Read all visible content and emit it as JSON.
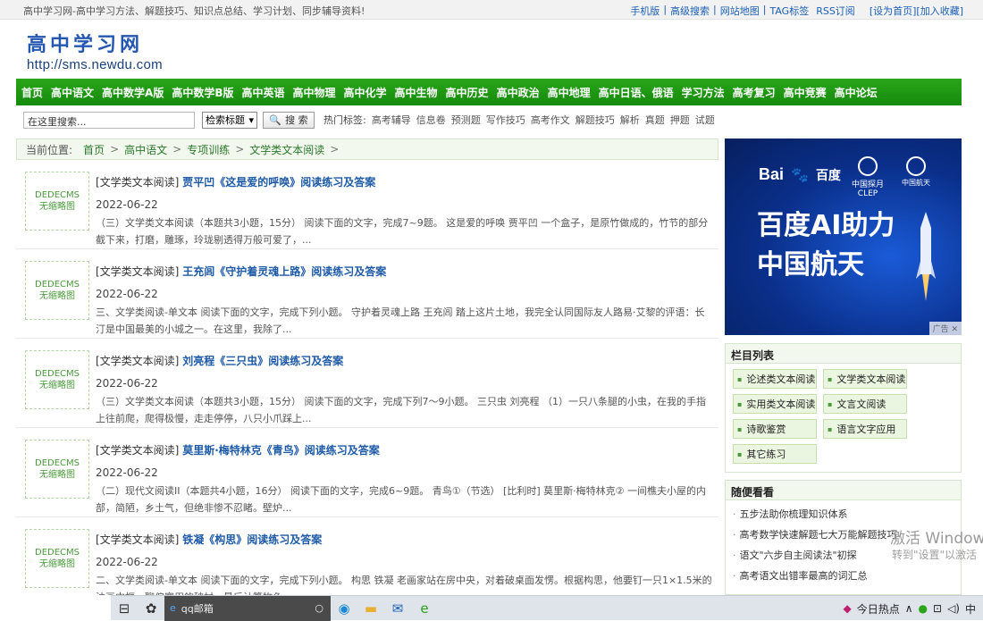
{
  "topbar": {
    "slogan": "高中学习网-高中学习方法、解题技巧、知识点总结、学习计划、同步辅导资料!",
    "links": [
      "手机版",
      "高级搜索",
      "网站地图",
      "TAG标签",
      "RSS订阅"
    ],
    "home": "[设为首页]",
    "fav": "[加入收藏]"
  },
  "logo": {
    "name": "高中学习网",
    "url": "http://sms.newdu.com"
  },
  "nav": [
    "首页",
    "高中语文",
    "高中数学A版",
    "高中数学B版",
    "高中英语",
    "高中物理",
    "高中化学",
    "高中生物",
    "高中历史",
    "高中政治",
    "高中地理",
    "高中日语、俄语",
    "学习方法",
    "高考复习",
    "高中竞赛",
    "高中论坛"
  ],
  "search": {
    "placeholder": "在这里搜索...",
    "select": "检索标题",
    "button": "搜 索",
    "hot_label": "热门标签:",
    "hot_tags": [
      "高考辅导",
      "信息卷",
      "预测题",
      "写作技巧",
      "高考作文",
      "解题技巧",
      "解析",
      "真题",
      "押题",
      "试题"
    ]
  },
  "breadcrumb": {
    "prefix": "当前位置:",
    "items": [
      "首页",
      "高中语文",
      "专项训练",
      "文学类文本阅读"
    ]
  },
  "thumb": {
    "line1": "DEDECMS",
    "line2": "无缩略图"
  },
  "articles": [
    {
      "cat": "[文学类文本阅读]",
      "title": "贾平凹《这是爱的呼唤》阅读练习及答案",
      "date": "2022-06-22",
      "desc": "（三）文学类文本阅读（本题共3小题，15分） 阅读下面的文字，完成7~9题。 这是爱的呼唤 贾平凹 一个盒子，是原竹做成的，竹节的部分截下来，打磨，雕琢，玲珑剔透得万般可爱了，..."
    },
    {
      "cat": "[文学类文本阅读]",
      "title": "王充闾《守护着灵魂上路》阅读练习及答案",
      "date": "2022-06-22",
      "desc": "三、文学类阅读-单文本 阅读下面的文字，完成下列小题。 守护着灵魂上路 王充闾 踏上这片土地，我完全认同国际友人路易·艾黎的评语：长汀是中国最美的小城之一。在这里，我除了..."
    },
    {
      "cat": "[文学类文本阅读]",
      "title": "刘亮程《三只虫》阅读练习及答案",
      "date": "2022-06-22",
      "desc": "（三）文学类文本阅读（本题共3小题，15分） 阅读下面的文字，完成下列7～9小题。 三只虫 刘亮程 （1）一只八条腿的小虫，在我的手指上往前爬，爬得极慢，走走停停，八只小爪踩上..."
    },
    {
      "cat": "[文学类文本阅读]",
      "title": "莫里斯·梅特林克《青鸟》阅读练习及答案",
      "date": "2022-06-22",
      "desc": "（二）现代文阅读II（本题共4小题，16分） 阅读下面的文字，完成6~9题。 青鸟①（节选） [比利时] 莫里斯·梅特林克② 一间樵夫小屋的内部，简陋，乡土气，但绝非惨不忍睹。壁炉..."
    },
    {
      "cat": "[文学类文本阅读]",
      "title": "铁凝《构思》阅读练习及答案",
      "date": "2022-06-22",
      "desc": "二、文学类阅读-单文本 阅读下面的文字，完成下列小题。 构思 铁凝 老画家站在房中央，对着破桌面发愣。根据构思，他要钉一只1×1.5米的油画内框，聊偏宽用的破材，最后计算物色..."
    }
  ],
  "ad": {
    "baidu": "Bai",
    "baidu2": "百度",
    "clep": "中国探月",
    "clep_en": "CLEP",
    "cnsa": "中国航天",
    "line1": "百度AI助力",
    "line2": "中国航天",
    "tag": "广告"
  },
  "columns": {
    "title": "栏目列表",
    "items": [
      "论述类文本阅读",
      "文学类文本阅读",
      "实用类文本阅读",
      "文言文阅读",
      "诗歌鉴赏",
      "语言文字应用",
      "其它练习"
    ]
  },
  "random": {
    "title": "随便看看",
    "items": [
      "五步法助你梳理知识体系",
      "高考数学快速解题七大万能解题技巧",
      "语文\"六步自主阅读法\"初探",
      "高考语文出错率最高的词汇总"
    ]
  },
  "watermark": {
    "line1": "激活 Windows",
    "line2": "转到\"设置\"以激活"
  },
  "taskbar": {
    "search": "qq邮箱",
    "hot": "今日热点"
  }
}
